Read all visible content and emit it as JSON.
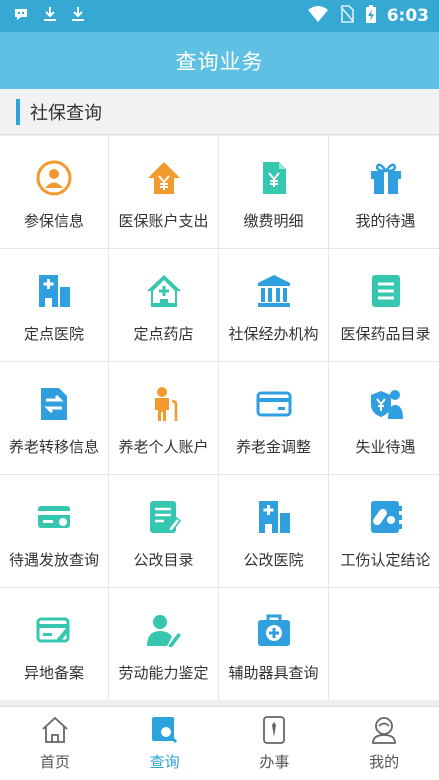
{
  "status_bar": {
    "time": "6:03"
  },
  "header": {
    "title": "查询业务"
  },
  "section": {
    "title": "社保查询"
  },
  "grid": {
    "items": [
      {
        "label": "参保信息",
        "icon": "person-circle-icon"
      },
      {
        "label": "医保账户支出",
        "icon": "house-yen-icon"
      },
      {
        "label": "缴费明细",
        "icon": "yen-document-icon"
      },
      {
        "label": "我的待遇",
        "icon": "gift-icon"
      },
      {
        "label": "定点医院",
        "icon": "hospital-building-icon"
      },
      {
        "label": "定点药店",
        "icon": "pharmacy-house-icon"
      },
      {
        "label": "社保经办机构",
        "icon": "institution-building-icon"
      },
      {
        "label": "医保药品目录",
        "icon": "list-document-icon"
      },
      {
        "label": "养老转移信息",
        "icon": "transfer-document-icon"
      },
      {
        "label": "养老个人账户",
        "icon": "elderly-person-icon"
      },
      {
        "label": "养老金调整",
        "icon": "bank-card-icon"
      },
      {
        "label": "失业待遇",
        "icon": "shield-person-icon"
      },
      {
        "label": "待遇发放查询",
        "icon": "payment-card-icon"
      },
      {
        "label": "公改目录",
        "icon": "edit-document-icon"
      },
      {
        "label": "公改医院",
        "icon": "hospital-building-icon"
      },
      {
        "label": "工伤认定结论",
        "icon": "pill-notebook-icon"
      },
      {
        "label": "异地备案",
        "icon": "card-pen-icon"
      },
      {
        "label": "劳动能力鉴定",
        "icon": "person-pen-icon"
      },
      {
        "label": "辅助器具查询",
        "icon": "medical-kit-icon"
      }
    ]
  },
  "tabs": [
    {
      "label": "首页",
      "icon": "home-icon"
    },
    {
      "label": "查询",
      "icon": "search-document-icon"
    },
    {
      "label": "办事",
      "icon": "clipboard-tie-icon"
    },
    {
      "label": "我的",
      "icon": "user-icon"
    }
  ],
  "colors": {
    "header": "#5ec0e2",
    "status_bar": "#35a8d4",
    "accent": "#2ba3dc",
    "icon_blue": "#2f9fe0",
    "icon_orange": "#f39a2d",
    "icon_teal": "#35c7b0"
  }
}
